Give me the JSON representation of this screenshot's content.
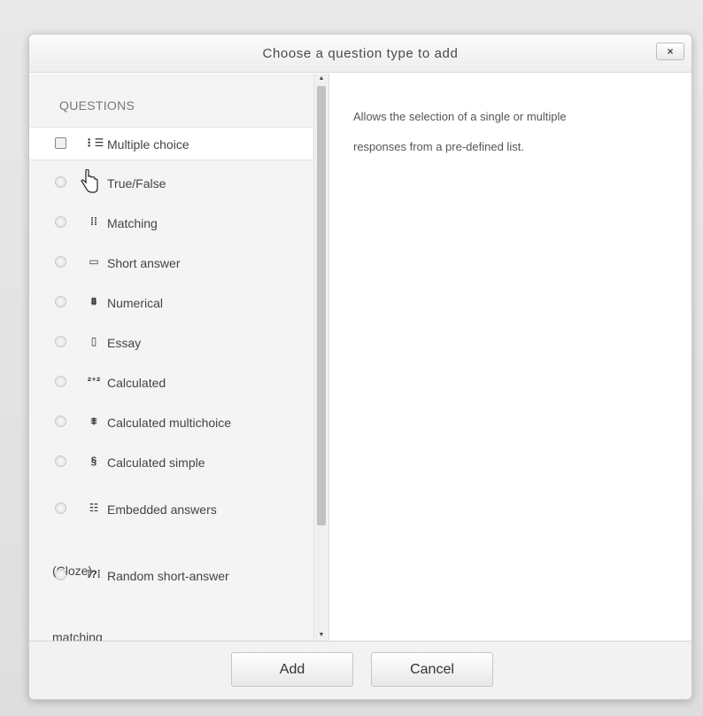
{
  "dialog": {
    "title": "Choose a question type to add",
    "close_label": "×"
  },
  "questions": {
    "heading": "QUESTIONS",
    "items": [
      {
        "label": "Multiple choice",
        "icon": "multiple-choice-icon",
        "glyph": "⋮☰"
      },
      {
        "label": "True/False",
        "icon": "true-false-icon",
        "glyph": "••"
      },
      {
        "label": "Matching",
        "icon": "matching-icon",
        "glyph": "⁞⁞"
      },
      {
        "label": "Short answer",
        "icon": "short-answer-icon",
        "glyph": "▭"
      },
      {
        "label": "Numerical",
        "icon": "numerical-icon",
        "glyph": "⩩"
      },
      {
        "label": "Essay",
        "icon": "essay-icon",
        "glyph": "▯"
      },
      {
        "label": "Calculated",
        "icon": "calculated-icon",
        "glyph": "²⁺²"
      },
      {
        "label": "Calculated multichoice",
        "icon": "calculated-multichoice-icon",
        "glyph": "⩨"
      },
      {
        "label": "Calculated simple",
        "icon": "calculated-simple-icon",
        "glyph": "§"
      },
      {
        "label": "Embedded answers",
        "label_wrap": "(Cloze)",
        "icon": "embedded-answers-icon",
        "glyph": "☷"
      },
      {
        "label": "Random short-answer",
        "label_wrap": "matching",
        "icon": "random-short-answer-icon",
        "glyph": "⁞?⁞"
      }
    ]
  },
  "description": {
    "line1": "Allows the selection of a single or multiple",
    "line2": "responses from a pre-defined list."
  },
  "footer": {
    "add_label": "Add",
    "cancel_label": "Cancel"
  },
  "scrollbar": {
    "up_arrow": "▲",
    "down_arrow": "▼"
  }
}
